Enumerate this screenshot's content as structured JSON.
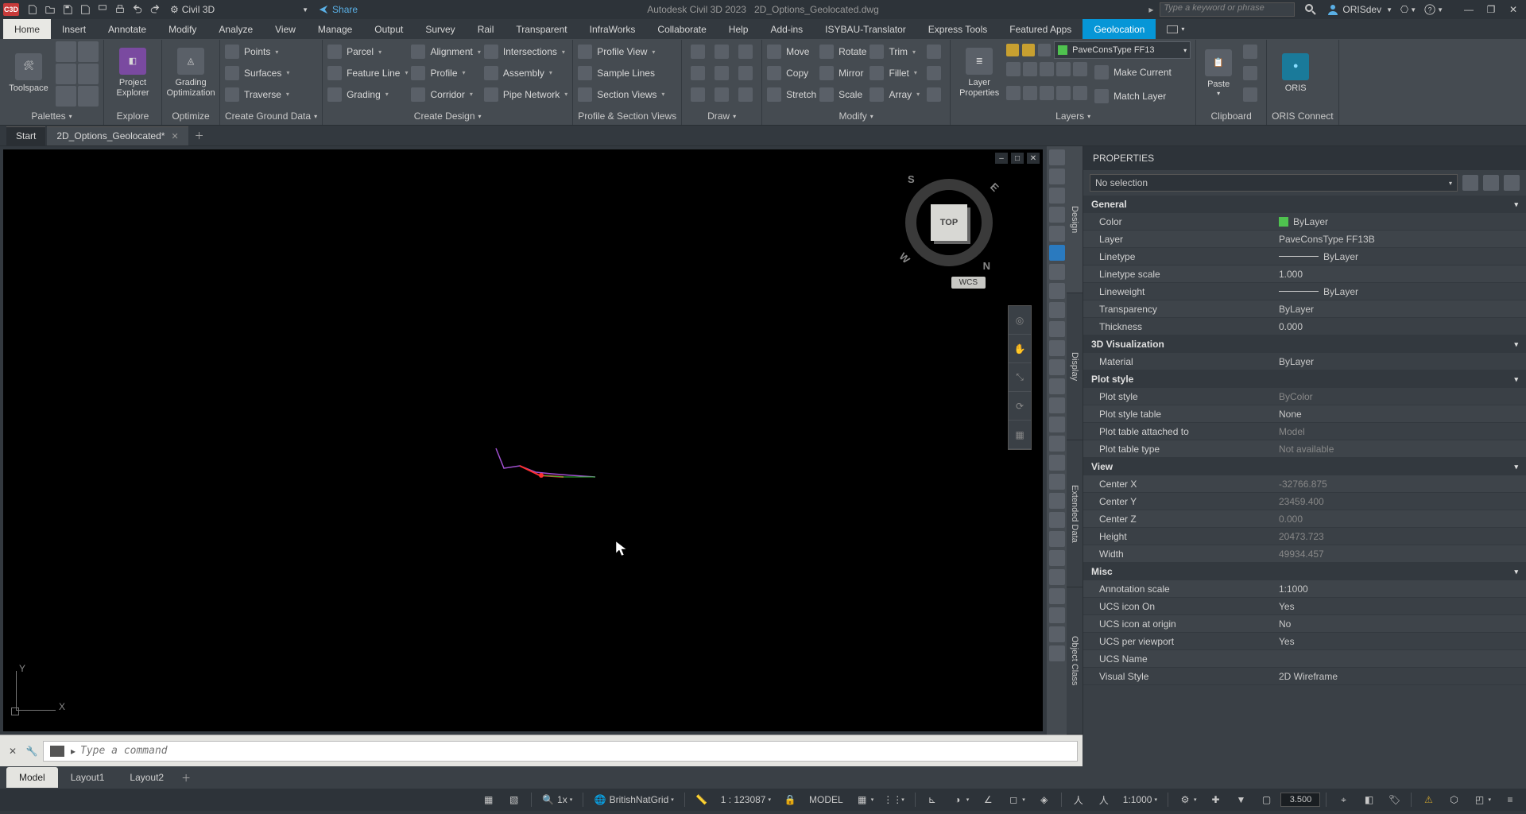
{
  "title_bar": {
    "app_badge": "C3D",
    "workspace": "Civil 3D",
    "share": "Share",
    "doc_title_app": "Autodesk Civil 3D 2023",
    "doc_title_file": "2D_Options_Geolocated.dwg",
    "search_placeholder": "Type a keyword or phrase",
    "user": "ORISdev"
  },
  "menu_tabs": [
    "Home",
    "Insert",
    "Annotate",
    "Modify",
    "Analyze",
    "View",
    "Manage",
    "Output",
    "Survey",
    "Rail",
    "Transparent",
    "InfraWorks",
    "Collaborate",
    "Help",
    "Add-ins",
    "ISYBAU-Translator",
    "Express Tools",
    "Featured Apps",
    "Geolocation"
  ],
  "ribbon": {
    "palettes": {
      "title": "Palettes",
      "toolspace": "Toolspace"
    },
    "explore": {
      "title": "Explore",
      "project_explorer": "Project\nExplorer"
    },
    "optimize": {
      "title": "Optimize",
      "grading": "Grading\nOptimization"
    },
    "create_ground": {
      "title": "Create Ground Data",
      "points": "Points",
      "surfaces": "Surfaces",
      "traverse": "Traverse"
    },
    "create_design": {
      "title": "Create Design",
      "parcel": "Parcel",
      "feature_line": "Feature Line",
      "grading": "Grading",
      "alignment": "Alignment",
      "profile": "Profile",
      "corridor": "Corridor",
      "intersections": "Intersections",
      "assembly": "Assembly",
      "pipe_network": "Pipe Network"
    },
    "profile_section": {
      "title": "Profile & Section Views",
      "profile_view": "Profile View",
      "sample_lines": "Sample Lines",
      "section_views": "Section Views"
    },
    "draw": {
      "title": "Draw"
    },
    "modify": {
      "title": "Modify",
      "move": "Move",
      "copy": "Copy",
      "stretch": "Stretch",
      "rotate": "Rotate",
      "mirror": "Mirror",
      "scale": "Scale",
      "trim": "Trim",
      "fillet": "Fillet",
      "array": "Array"
    },
    "layers": {
      "title": "Layers",
      "layer_props": "Layer\nProperties",
      "combo": "PaveConsType FF13",
      "make_current": "Make Current",
      "match_layer": "Match Layer"
    },
    "clipboard": {
      "title": "Clipboard",
      "paste": "Paste"
    },
    "oris": {
      "title": "ORIS Connect",
      "oris": "ORIS"
    }
  },
  "file_tabs": {
    "start": "Start",
    "file": "2D_Options_Geolocated*"
  },
  "viewport": {
    "viewcube": "TOP",
    "wcs": "WCS",
    "compass": {
      "n": "N",
      "s": "S",
      "e": "E",
      "w": "W"
    }
  },
  "vert_tabs": [
    "Design",
    "Display",
    "Extended Data",
    "Object Class"
  ],
  "properties": {
    "title": "PROPERTIES",
    "selection": "No selection",
    "sections": {
      "general": "General",
      "viz": "3D Visualization",
      "plot": "Plot style",
      "view": "View",
      "misc": "Misc"
    },
    "general": {
      "color_k": "Color",
      "color_v": "ByLayer",
      "layer_k": "Layer",
      "layer_v": "PaveConsType FF13B",
      "linetype_k": "Linetype",
      "linetype_v": "ByLayer",
      "ltscale_k": "Linetype scale",
      "ltscale_v": "1.000",
      "lweight_k": "Lineweight",
      "lweight_v": "ByLayer",
      "transp_k": "Transparency",
      "transp_v": "ByLayer",
      "thick_k": "Thickness",
      "thick_v": "0.000"
    },
    "viz": {
      "material_k": "Material",
      "material_v": "ByLayer"
    },
    "plot": {
      "ps_k": "Plot style",
      "ps_v": "ByColor",
      "pst_k": "Plot style table",
      "pst_v": "None",
      "pta_k": "Plot table attached to",
      "pta_v": "Model",
      "ptt_k": "Plot table type",
      "ptt_v": "Not available"
    },
    "view": {
      "cx_k": "Center X",
      "cx_v": "-32766.875",
      "cy_k": "Center Y",
      "cy_v": "23459.400",
      "cz_k": "Center Z",
      "cz_v": "0.000",
      "h_k": "Height",
      "h_v": "20473.723",
      "w_k": "Width",
      "w_v": "49934.457"
    },
    "misc": {
      "as_k": "Annotation scale",
      "as_v": "1:1000",
      "ui_k": "UCS icon On",
      "ui_v": "Yes",
      "uo_k": "UCS icon at origin",
      "uo_v": "No",
      "up_k": "UCS per viewport",
      "up_v": "Yes",
      "un_k": "UCS Name",
      "un_v": "",
      "vs_k": "Visual Style",
      "vs_v": "2D Wireframe"
    }
  },
  "cmd": {
    "placeholder": "Type a command"
  },
  "layout_tabs": [
    "Model",
    "Layout1",
    "Layout2"
  ],
  "status": {
    "zoom": "1x",
    "coord": "BritishNatGrid",
    "scale": "1 : 123087",
    "space": "MODEL",
    "annoscale": "1:1000",
    "decimal": "3.500"
  }
}
